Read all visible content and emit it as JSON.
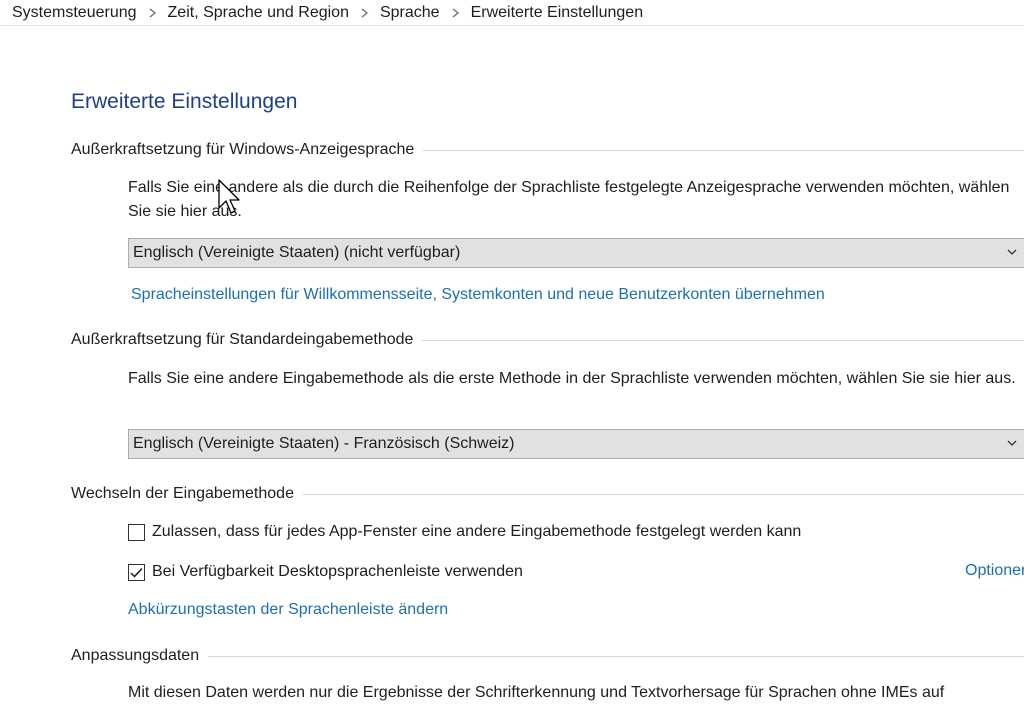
{
  "breadcrumb": {
    "items": [
      "Systemsteuerung",
      "Zeit, Sprache und Region",
      "Sprache",
      "Erweiterte Einstellungen"
    ]
  },
  "page": {
    "title": "Erweiterte Einstellungen"
  },
  "display_language": {
    "header": "Außerkraftsetzung für Windows-Anzeigesprache",
    "description": "Falls Sie eine andere als die durch die Reihenfolge der Sprachliste festgelegte Anzeigesprache verwenden möchten, wählen Sie sie hier aus.",
    "selected": "Englisch (Vereinigte Staaten) (nicht verfügbar)",
    "apply_link": "Spracheinstellungen für Willkommensseite, Systemkonten und neue Benutzerkonten übernehmen"
  },
  "input_method": {
    "header": "Außerkraftsetzung für Standardeingabemethode",
    "description": "Falls Sie eine andere Eingabemethode als die erste Methode in der Sprachliste verwenden möchten, wählen Sie sie hier aus.",
    "selected": "Englisch (Vereinigte Staaten) - Französisch (Schweiz)"
  },
  "switching": {
    "header": "Wechseln der Eingabemethode",
    "per_app_label": "Zulassen, dass für jedes App-Fenster eine andere Eingabemethode festgelegt werden kann",
    "per_app_checked": false,
    "language_bar_label": "Bei Verfügbarkeit Desktopsprachenleiste verwenden",
    "language_bar_checked": true,
    "options_link": "Optionen",
    "hotkeys_link": "Abkürzungstasten der Sprachenleiste ändern"
  },
  "personalization": {
    "header": "Anpassungsdaten",
    "description": "Mit diesen Daten werden nur die Ergebnisse der Schrifterkennung und Textvorhersage für Sprachen ohne IMEs auf"
  },
  "colors": {
    "title": "#1e3f8c",
    "link": "#1c6fb2",
    "dropdown_bg": "#e1e1e1"
  }
}
